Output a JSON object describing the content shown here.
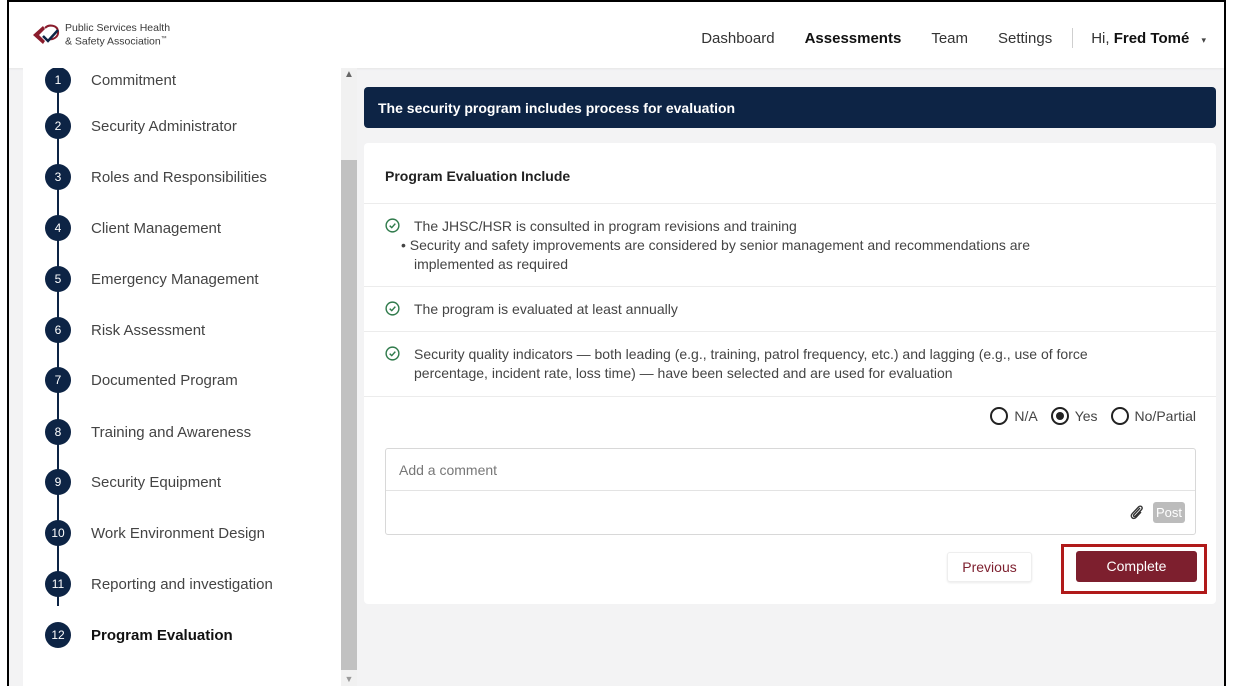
{
  "brand": {
    "line1": "Public Services Health",
    "line2": "& Safety Association",
    "tm": "™"
  },
  "nav": {
    "items": [
      "Dashboard",
      "Assessments",
      "Team",
      "Settings"
    ],
    "greeting": "Hi,",
    "user": "Fred Tomé",
    "caret": "▾"
  },
  "sidebar": {
    "steps": [
      {
        "num": "1",
        "label": "Commitment"
      },
      {
        "num": "2",
        "label": "Security Administrator"
      },
      {
        "num": "3",
        "label": "Roles and Responsibilities"
      },
      {
        "num": "4",
        "label": "Client Management"
      },
      {
        "num": "5",
        "label": "Emergency Management"
      },
      {
        "num": "6",
        "label": "Risk Assessment"
      },
      {
        "num": "7",
        "label": "Documented Program"
      },
      {
        "num": "8",
        "label": "Training and Awareness"
      },
      {
        "num": "9",
        "label": "Security Equipment"
      },
      {
        "num": "10",
        "label": "Work Environment Design"
      },
      {
        "num": "11",
        "label": "Reporting and investigation"
      },
      {
        "num": "12",
        "label": "Program Evaluation"
      }
    ]
  },
  "main": {
    "header": "The security program includes process for evaluation",
    "card_title": "Program Evaluation Include",
    "items": [
      "The JHSC/HSR is consulted in program revisions and training",
      "The program is evaluated at least annually",
      "Security quality indicators — both leading (e.g., training, patrol frequency, etc.) and lagging (e.g., use of force"
    ],
    "bullet": "• Security and safety improvements are considered by senior management and recommendations are",
    "bullet_cont": "implemented as required",
    "item3_cont": "percentage, incident rate, loss time) — have been selected and are used for evaluation",
    "radios": [
      {
        "label": "N/A",
        "selected": false
      },
      {
        "label": "Yes",
        "selected": true
      },
      {
        "label": "No/Partial",
        "selected": false
      }
    ],
    "comment_placeholder": "Add a comment",
    "post_label": "Post",
    "previous_label": "Previous",
    "complete_label": "Complete"
  },
  "colors": {
    "navy": "#0d2445",
    "maroon": "#7d1f2e",
    "highlight": "#b01a1a"
  }
}
